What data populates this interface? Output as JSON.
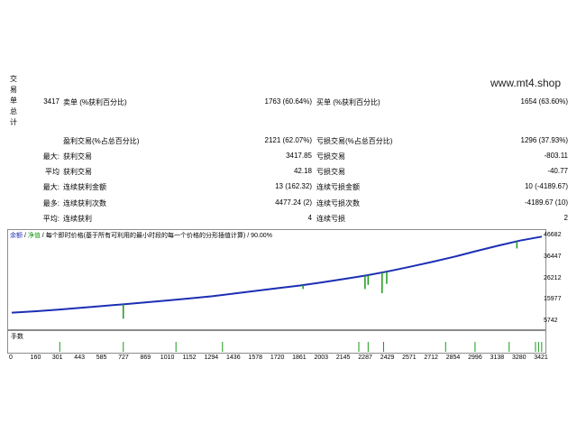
{
  "section_label": [
    "交",
    "易",
    "单",
    "总",
    "计"
  ],
  "watermark": "www.mt4.shop",
  "stats": {
    "total_trades": "3417",
    "short_label": "卖单 (%获利百分比)",
    "short_value": "1763 (60.64%)",
    "long_label": "买单 (%获利百分比)",
    "long_value": "1654 (63.60%)",
    "profit_trades_label": "盈利交易(%占总百分比)",
    "profit_trades_value": "2121 (62.07%)",
    "loss_trades_label": "亏损交易(%占总百分比)",
    "loss_trades_value": "1296 (37.93%)",
    "largest_prefix": "最大:",
    "largest_profit_label": "获利交易",
    "largest_profit_value": "3417.85",
    "largest_loss_label": "亏损交易",
    "largest_loss_value": "-803.11",
    "average_prefix": "平均",
    "average_profit_label": "获利交易",
    "average_profit_value": "42.18",
    "average_loss_label": "亏损交易",
    "average_loss_value": "-40.77",
    "max_prefix": "最大:",
    "max_consec_wins_label": "连续获利金额",
    "max_consec_wins_value": "13 (162.32)",
    "max_consec_losses_label": "连续亏损金额",
    "max_consec_losses_value": "10 (-4189.67)",
    "maximal_prefix": "最多:",
    "maximal_consec_profit_label": "连续获利次数",
    "maximal_consec_profit_value": "4477.24 (2)",
    "maximal_consec_loss_label": "连续亏损次数",
    "maximal_consec_loss_value": "-4189.67 (10)",
    "avg_consec_prefix": "平均:",
    "avg_consec_wins_label": "连续获利",
    "avg_consec_wins_value": "4",
    "avg_consec_losses_label": "连续亏损",
    "avg_consec_losses_value": "2"
  },
  "chart_legend": {
    "balance": "余额",
    "sep1": " / ",
    "equity": "净值",
    "sep2": " / ",
    "desc": "每个即时价格(基于所有可利用的最小时段的每一个价格的分形插值计算) / 90.00%"
  },
  "lot_label": "手数",
  "colors": {
    "balance": "#1c2fb4",
    "equity": "#1a9a1a",
    "border": "#8c8c8c"
  },
  "chart_data": {
    "type": "line",
    "x_ticks": [
      "0",
      "160",
      "301",
      "443",
      "585",
      "727",
      "869",
      "1010",
      "1152",
      "1294",
      "1436",
      "1578",
      "1720",
      "1861",
      "2003",
      "2145",
      "2287",
      "2429",
      "2571",
      "2712",
      "2854",
      "2996",
      "3138",
      "3280",
      "3421"
    ],
    "y_ticks": [
      "46682",
      "36447",
      "26212",
      "15977",
      "5742"
    ],
    "xlim": [
      0,
      3421
    ],
    "ylim": [
      3000,
      49000
    ],
    "series": [
      {
        "name": "余额",
        "x": [
          0,
          160,
          301,
          443,
          585,
          727,
          869,
          1010,
          1152,
          1294,
          1436,
          1578,
          1720,
          1861,
          2003,
          2145,
          2287,
          2429,
          2571,
          2712,
          2854,
          2996,
          3138,
          3280,
          3421
        ],
        "y": [
          10100,
          10800,
          11600,
          12400,
          13300,
          14200,
          15100,
          16000,
          17000,
          18000,
          19300,
          20600,
          21900,
          23200,
          24700,
          26300,
          28000,
          30000,
          32200,
          34500,
          37000,
          39700,
          42300,
          44800,
          46682
        ]
      },
      {
        "name": "净值",
        "x": [
          720,
          1880,
          2280,
          2300,
          2390,
          2420,
          3260
        ],
        "y": [
          7200,
          21500,
          21500,
          23500,
          19500,
          24000,
          41000
        ]
      }
    ],
    "lots_x": [
      310,
      720,
      1060,
      1360,
      2240,
      2300,
      2400,
      2800,
      2990,
      3210,
      3380,
      3400,
      3420
    ]
  }
}
